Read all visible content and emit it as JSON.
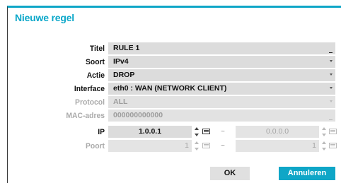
{
  "dialog": {
    "title": "Nieuwe regel",
    "accent_color": "#0fa6c7"
  },
  "form": {
    "titel": {
      "label": "Titel",
      "value": "RULE 1"
    },
    "soort": {
      "label": "Soort",
      "value": "IPv4"
    },
    "actie": {
      "label": "Actie",
      "value": "DROP"
    },
    "interface": {
      "label": "Interface",
      "value": "eth0 : WAN (NETWORK CLIENT)"
    },
    "protocol": {
      "label": "Protocol",
      "value": "ALL",
      "disabled": true
    },
    "mac": {
      "label": "MAC-adres",
      "value": "000000000000",
      "disabled": true
    },
    "ip": {
      "label": "IP",
      "from": "1.0.0.1",
      "to": "0.0.0.0",
      "separator": "~"
    },
    "poort": {
      "label": "Poort",
      "from": "1",
      "to": "1",
      "separator": "~",
      "disabled": true
    }
  },
  "buttons": {
    "ok": "OK",
    "cancel": "Annuleren"
  },
  "icons": {
    "dropdown": "chevron-down-icon",
    "spinner": "spin-arrows-icon",
    "keyboard": "keyboard-icon"
  }
}
